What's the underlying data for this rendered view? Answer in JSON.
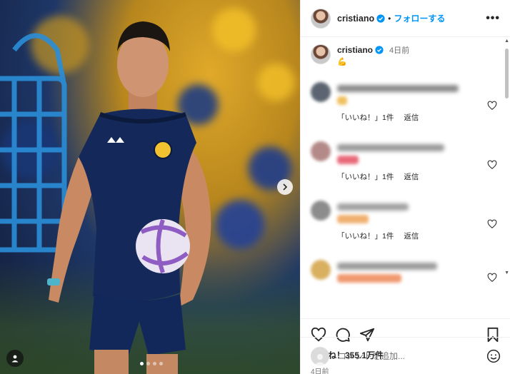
{
  "post": {
    "username": "cristiano",
    "follow_label": "フォローする",
    "separator": "•",
    "more_label": "•••"
  },
  "caption": {
    "username": "cristiano",
    "time": "4日前",
    "emoji": "💪"
  },
  "comments": [
    {
      "avatar_color": "#5b6470",
      "line_color": "#8a8a8a",
      "emoji_color": "#f0c060",
      "likes_label": "「いいね！」1件",
      "reply_label": "返信"
    },
    {
      "avatar_color": "#b48a88",
      "line_color": "#9a9a9a",
      "emoji_color": "#e86a7a",
      "likes_label": "「いいね！」1件",
      "reply_label": "返信"
    },
    {
      "avatar_color": "#8c8c8c",
      "line_color": "#a0a0a0",
      "emoji_color": "#f0b070",
      "likes_label": "「いいね！」1件",
      "reply_label": "返信"
    },
    {
      "avatar_color": "#d8b060",
      "line_color": "#9a9a9a",
      "emoji_color": "#f09a70"
    }
  ],
  "likes": "いいね！355.1万件",
  "post_time": "4日前",
  "add_comment": {
    "placeholder": "コメントを追加..."
  },
  "colors": {
    "accent": "#0095f6",
    "verified": "#0095f6"
  },
  "icons": [
    "heart-icon",
    "comment-icon",
    "share-icon",
    "bookmark-icon",
    "smile-icon",
    "chevron-right-icon",
    "user-tag-icon"
  ]
}
